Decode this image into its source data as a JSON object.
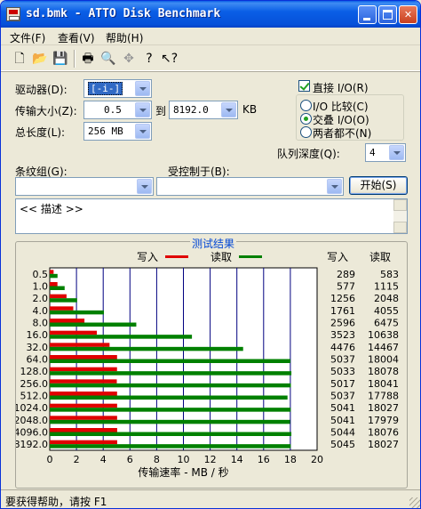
{
  "window": {
    "title": "sd.bmk - ATTO Disk Benchmark"
  },
  "menu": {
    "items": [
      "文件(F)",
      "查看(V)",
      "帮助(H)"
    ]
  },
  "toolbar": {
    "icons": [
      "new-file-icon",
      "open-folder-icon",
      "save-icon",
      "print-icon",
      "print-preview-icon",
      "move-icon",
      "help-icon",
      "context-help-icon"
    ]
  },
  "settings": {
    "drive_label": "驱动器(D):",
    "drive_value": "[-i-]",
    "transfer_label": "传输大小(Z):",
    "transfer_from": "0.5",
    "transfer_to_label": "到",
    "transfer_to": "8192.0",
    "transfer_unit": "KB",
    "length_label": "总长度(L):",
    "length_value": "256 MB",
    "direct_io_label": "直接 I/O(R)",
    "radio_io_compare": "I/O 比较(C)",
    "radio_overlap_io": "交叠 I/O(O)",
    "radio_neither": "两者都不(N)",
    "queue_label": "队列深度(Q):",
    "queue_value": "4",
    "stripe_label": "条纹组(G):",
    "controlled_label": "受控制于(B):",
    "start_button": "开始(S)",
    "description": "<< 描述 >>"
  },
  "results": {
    "title": "测试结果",
    "legend_write": "写入",
    "legend_read": "读取",
    "col_write": "写入",
    "col_read": "读取",
    "xlabel": "传输速率 - MB / 秒"
  },
  "colors": {
    "write": "#e00000",
    "read": "#008000",
    "grid": "#000080"
  },
  "chart_data": {
    "type": "bar",
    "orientation": "horizontal",
    "categories": [
      "0.5",
      "1.0",
      "2.0",
      "4.0",
      "8.0",
      "16.0",
      "32.0",
      "64.0",
      "128.0",
      "256.0",
      "512.0",
      "1024.0",
      "2048.0",
      "4096.0",
      "8192.0"
    ],
    "series": [
      {
        "name": "写入",
        "values": [
          289,
          577,
          1256,
          1761,
          2596,
          3523,
          4476,
          5037,
          5033,
          5017,
          5037,
          5041,
          5041,
          5044,
          5045
        ]
      },
      {
        "name": "读取",
        "values": [
          583,
          1115,
          2048,
          4055,
          6475,
          10638,
          14467,
          18004,
          18078,
          18041,
          17788,
          18027,
          17979,
          18076,
          18027
        ]
      }
    ],
    "x_ticks": [
      "0",
      "2",
      "4",
      "6",
      "8",
      "10",
      "12",
      "14",
      "16",
      "18",
      "20"
    ],
    "xlim": [
      0,
      20
    ],
    "xlabel": "传输速率 - MB / 秒",
    "grid": true,
    "legend": "top"
  },
  "status": {
    "text": "要获得帮助，请按 F1"
  }
}
